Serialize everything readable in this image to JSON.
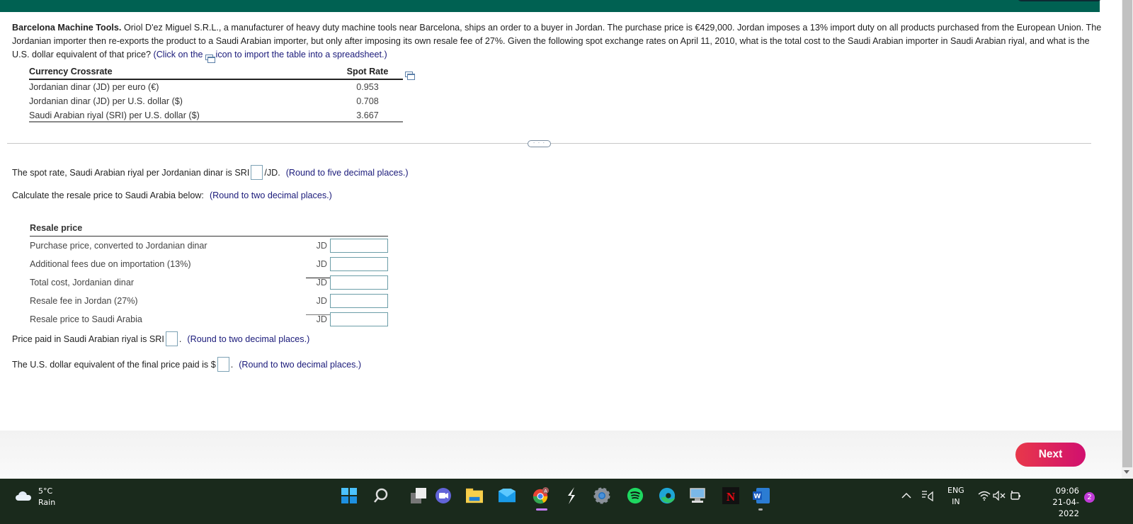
{
  "problem": {
    "title": "Barcelona Machine Tools.",
    "body": "Oriol D'ez Miguel S.R.L., a manufacturer of heavy duty machine tools near Barcelona, ships an order to a buyer in Jordan. The purchase price is €429,000. Jordan imposes a 13% import duty on all products purchased from the European Union. The Jordanian importer then re-exports the product to a Saudi Arabian importer, but only after imposing its own resale fee of 27%. Given the following spot exchange rates on April 11, 2010, what is the total cost to the Saudi Arabian importer in Saudi Arabian riyal, and what is the U.S. dollar equivalent of that price?",
    "hint_prefix": "(Click on the",
    "hint_suffix": "icon to import the table into a spreadsheet.)"
  },
  "rate_table": {
    "headers": [
      "Currency Crossrate",
      "Spot Rate"
    ],
    "rows": [
      {
        "label": "Jordanian dinar (JD) per euro (€)",
        "rate": "0.953"
      },
      {
        "label": "Jordanian dinar (JD) per U.S. dollar ($)",
        "rate": "0.708"
      },
      {
        "label": "Saudi Arabian riyal (SRI) per U.S. dollar ($)",
        "rate": "3.667"
      }
    ]
  },
  "expand_label": "· · ·",
  "questions": {
    "spot_rate": {
      "prefix": "The spot rate, Saudi Arabian riyal per Jordanian dinar is SRI",
      "suffix": "/JD.",
      "hint": "(Round to five decimal places.)",
      "value": ""
    },
    "resale_intro": {
      "text": "Calculate the resale price to Saudi Arabia below:",
      "hint": "(Round to two decimal places.)"
    },
    "price_sri": {
      "prefix": "Price paid in Saudi Arabian riyal is SRI",
      "suffix": ".",
      "hint": "(Round to two decimal places.)",
      "value": ""
    },
    "price_usd": {
      "prefix": "The U.S. dollar equivalent of the final price paid is $",
      "suffix": ".",
      "hint": "(Round to two decimal places.)",
      "value": ""
    }
  },
  "resale_table": {
    "title": "Resale price",
    "rows": [
      {
        "label": "Purchase price, converted to Jordanian dinar",
        "currency": "JD",
        "value": ""
      },
      {
        "label": "Additional fees due on importation (13%)",
        "currency": "JD",
        "value": ""
      },
      {
        "label": "Total cost, Jordanian dinar",
        "currency": "JD",
        "value": ""
      },
      {
        "label": "Resale fee in Jordan (27%)",
        "currency": "JD",
        "value": ""
      },
      {
        "label": "Resale price to Saudi Arabia",
        "currency": "JD",
        "value": ""
      }
    ]
  },
  "footer": {
    "next_label": "Next"
  },
  "taskbar": {
    "weather": {
      "temp": "5°C",
      "condition": "Rain"
    },
    "apps": [
      "start",
      "search",
      "task-view",
      "teams-chat",
      "file-explorer",
      "mail",
      "chrome",
      "app-s",
      "settings",
      "spotify",
      "edge",
      "remote-desktop",
      "netflix",
      "word"
    ],
    "tray": {
      "lang_top": "ENG",
      "lang_bottom": "IN"
    },
    "clock": {
      "time": "09:06",
      "date": "21-04-2022"
    },
    "notifications": "2"
  },
  "colors": {
    "header": "#006152",
    "next_button": "#e0245e",
    "taskbar": "#1a2a1c"
  }
}
